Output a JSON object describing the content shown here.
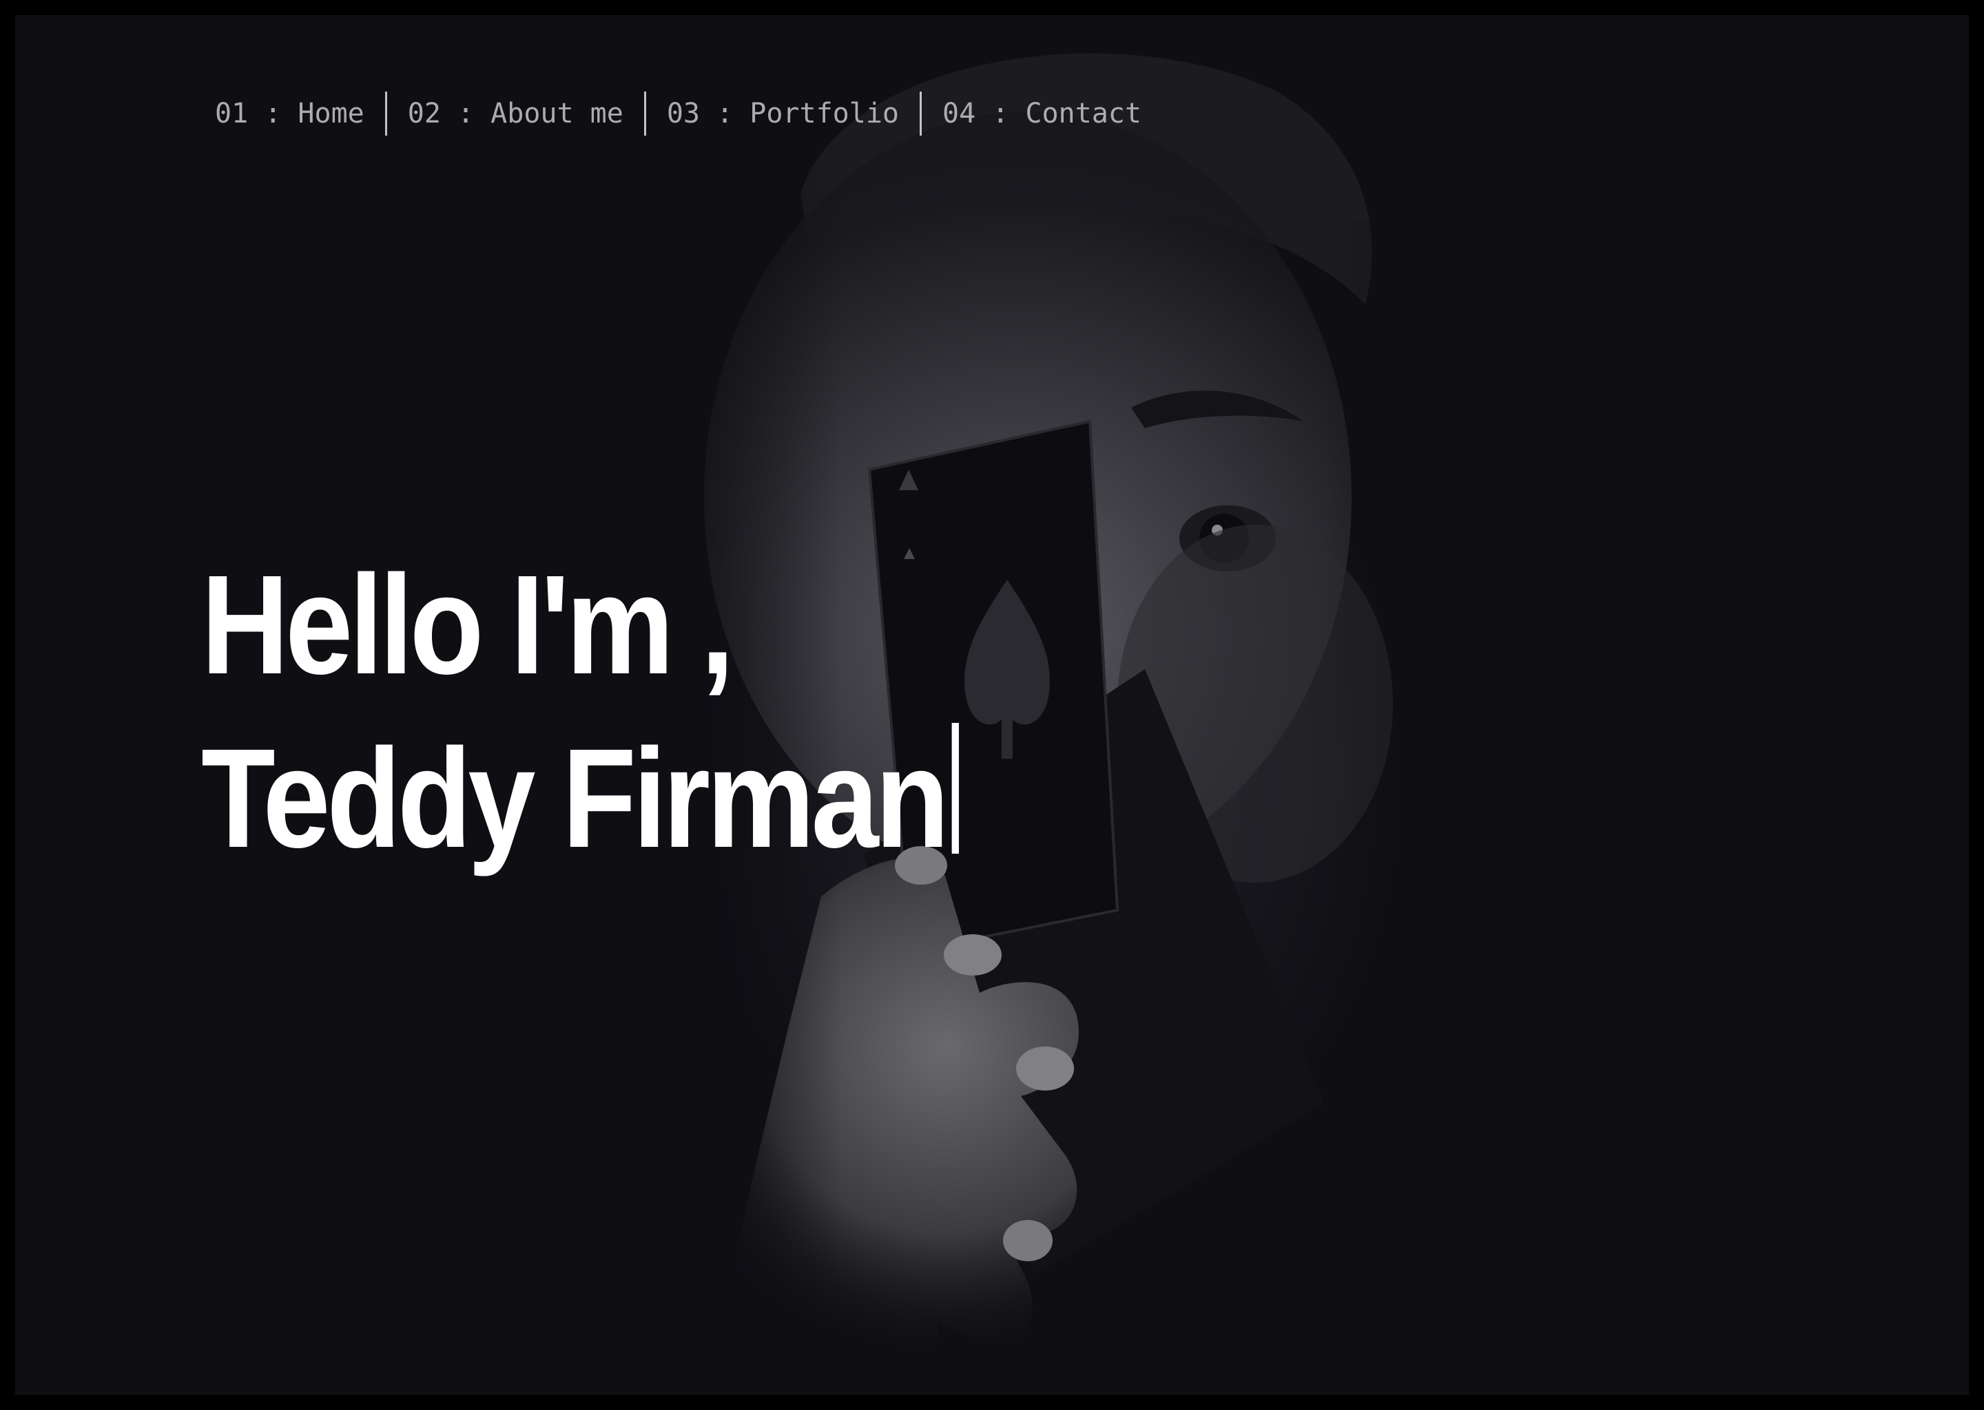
{
  "nav": {
    "items": [
      {
        "label": "01 : Home"
      },
      {
        "label": "02 : About me"
      },
      {
        "label": "03 : Portfolio"
      },
      {
        "label": "04 : Contact"
      }
    ]
  },
  "hero": {
    "greeting": "Hello I'm ,",
    "name": "Teddy Firman"
  },
  "colors": {
    "background": "#0f0e13",
    "text": "#ffffff",
    "nav_text": "#c7c7cc"
  }
}
